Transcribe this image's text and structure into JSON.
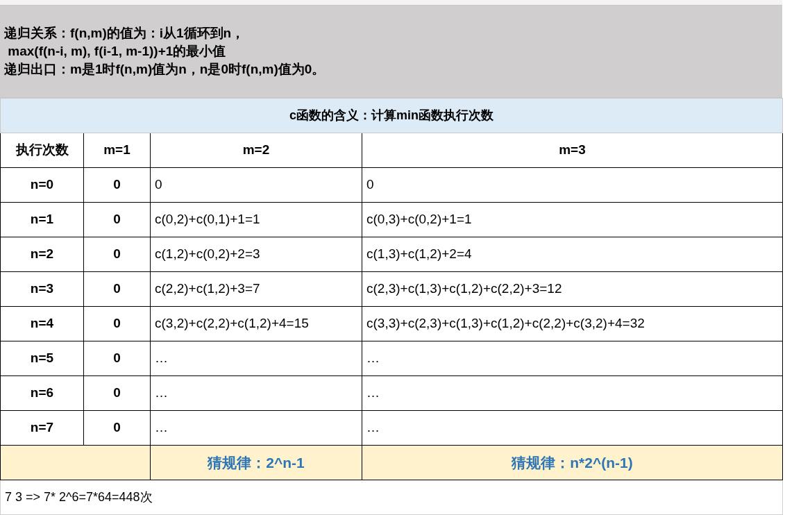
{
  "note_lines": [
    "递归关系：f(n,m)的值为：i从1循环到n，",
    " max(f(n-i, m), f(i-1, m-1))+1的最小值",
    "递归出口：m是1时f(n,m)值为n，n是0时f(n,m)值为0。"
  ],
  "title": "c函数的含义：计算min函数执行次数",
  "table": {
    "columns": [
      "执行次数",
      "m=1",
      "m=2",
      "m=3"
    ],
    "rows": [
      [
        "n=0",
        "0",
        "0",
        "0"
      ],
      [
        "n=1",
        "0",
        "c(0,2)+c(0,1)+1=1",
        "c(0,3)+c(0,2)+1=1"
      ],
      [
        "n=2",
        "0",
        "c(1,2)+c(0,2)+2=3",
        "c(1,3)+c(1,2)+2=4"
      ],
      [
        "n=3",
        "0",
        "c(2,2)+c(1,2)+3=7",
        "c(2,3)+c(1,3)+c(1,2)+c(2,2)+3=12"
      ],
      [
        "n=4",
        "0",
        "c(3,2)+c(2,2)+c(1,2)+4=15",
        "c(3,3)+c(2,3)+c(1,3)+c(1,2)+c(2,2)+c(3,2)+4=32"
      ],
      [
        "n=5",
        "0",
        "…",
        "…"
      ],
      [
        "n=6",
        "0",
        "…",
        "…"
      ],
      [
        "n=7",
        "0",
        "…",
        "…"
      ]
    ]
  },
  "patterns": [
    "猜规律：2^n-1",
    "猜规律：n*2^(n-1)"
  ],
  "footnote": "7 3 => 7* 2^6=7*64=448次"
}
